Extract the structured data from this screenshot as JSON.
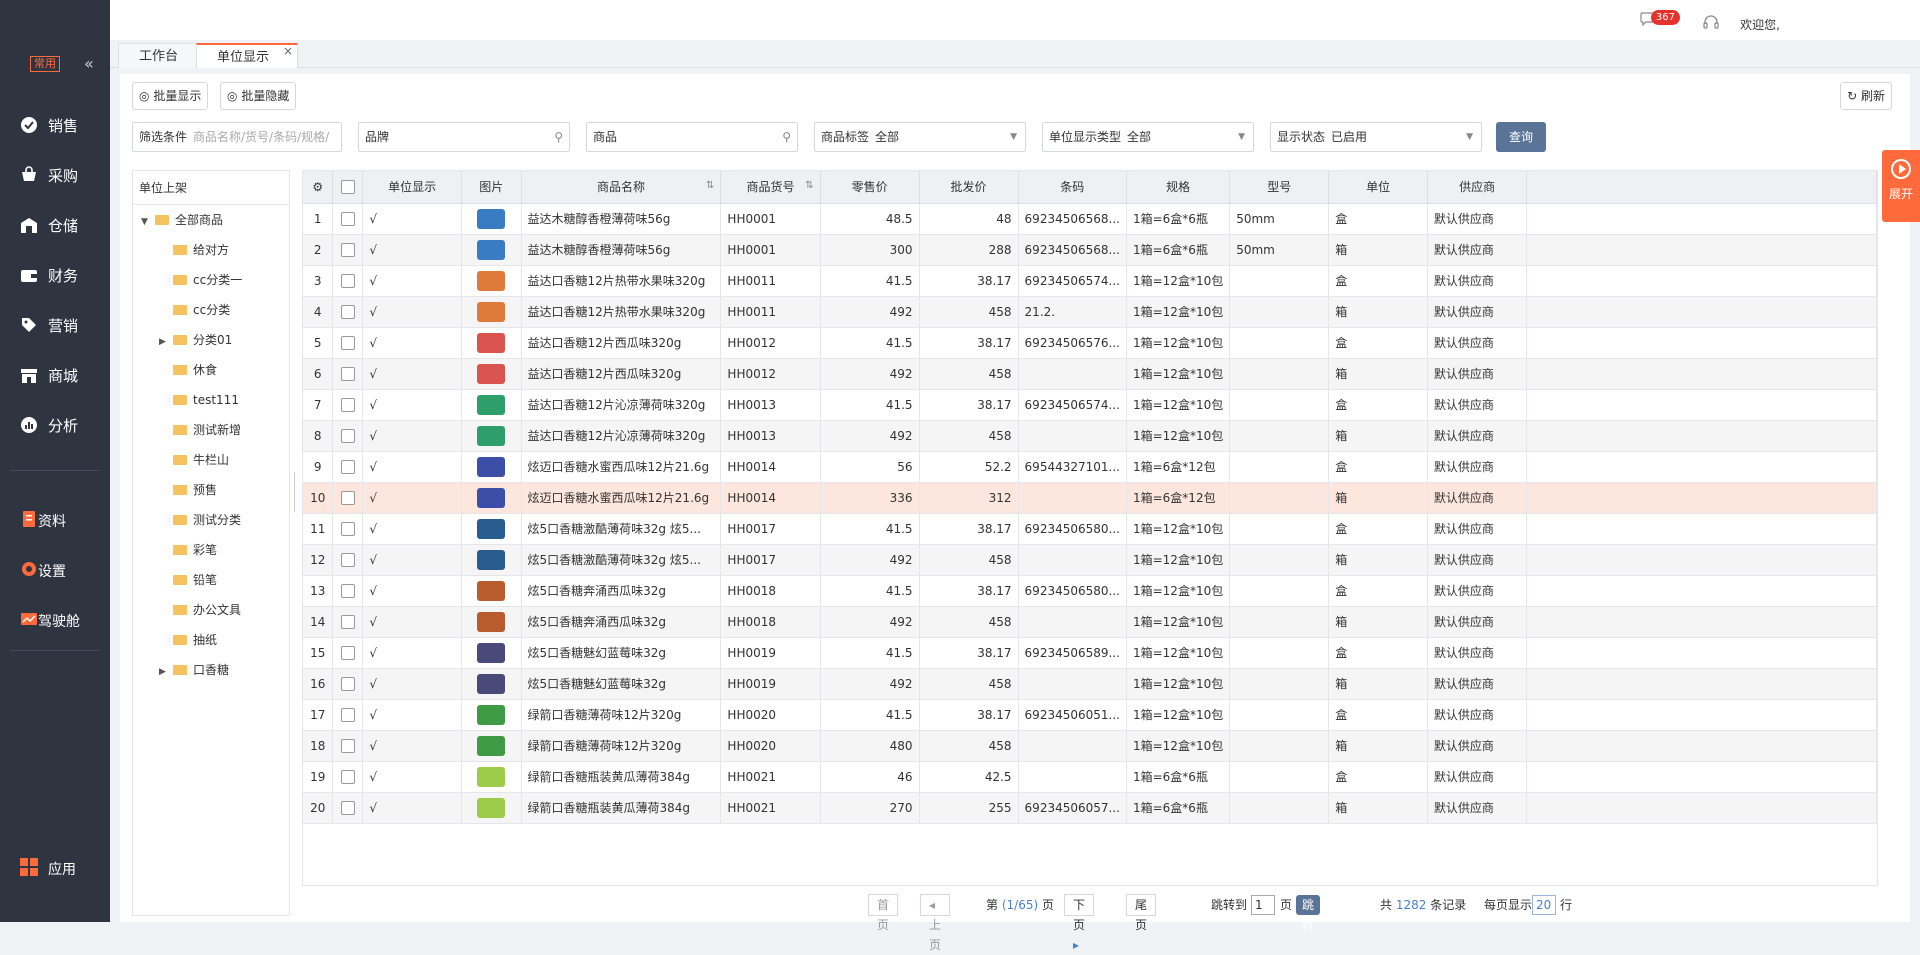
{
  "sidebar": {
    "common_tag": "常用",
    "collapse": "«",
    "items": [
      {
        "label": "销售",
        "icon": "sales-icon"
      },
      {
        "label": "采购",
        "icon": "purchase-icon"
      },
      {
        "label": "仓储",
        "icon": "warehouse-icon"
      },
      {
        "label": "财务",
        "icon": "finance-icon"
      },
      {
        "label": "营销",
        "icon": "marketing-icon"
      },
      {
        "label": "商城",
        "icon": "mall-icon"
      },
      {
        "label": "分析",
        "icon": "analysis-icon"
      }
    ],
    "items2": [
      {
        "label": "资料",
        "icon": "data-icon"
      },
      {
        "label": "设置",
        "icon": "settings-icon"
      },
      {
        "label": "驾驶舱",
        "icon": "cockpit-icon"
      }
    ],
    "app": "应用"
  },
  "topbar": {
    "badge": "367",
    "welcome": "欢迎您,"
  },
  "tabs": [
    {
      "label": "工作台"
    },
    {
      "label": "单位显示"
    }
  ],
  "toolbar": {
    "batch_show": "批量显示",
    "batch_hide": "批量隐藏",
    "refresh": "刷新"
  },
  "filters": {
    "f1_label": "筛选条件",
    "f1_placeholder": "商品名称/货号/条码/规格/",
    "f2_placeholder": "品牌",
    "f3_placeholder": "商品",
    "f4_label": "商品标签",
    "f4_value": "全部",
    "f5_label": "单位显示类型",
    "f5_value": "全部",
    "f6_label": "显示状态",
    "f6_value": "已启用",
    "query": "查询"
  },
  "tree": {
    "header": "单位上架",
    "root": "全部商品",
    "items": [
      {
        "label": "给对方",
        "expandable": false
      },
      {
        "label": "cc分类一",
        "expandable": false
      },
      {
        "label": "cc分类",
        "expandable": false
      },
      {
        "label": "分类01",
        "expandable": true
      },
      {
        "label": "休食",
        "expandable": false
      },
      {
        "label": "test111",
        "expandable": false
      },
      {
        "label": "测试新增",
        "expandable": false
      },
      {
        "label": "牛栏山",
        "expandable": false
      },
      {
        "label": "预售",
        "expandable": false
      },
      {
        "label": "测试分类",
        "expandable": false
      },
      {
        "label": "彩笔",
        "expandable": false
      },
      {
        "label": "铅笔",
        "expandable": false
      },
      {
        "label": "办公文具",
        "expandable": false
      },
      {
        "label": "抽纸",
        "expandable": false
      },
      {
        "label": "口香糖",
        "expandable": true
      }
    ]
  },
  "table": {
    "headers": [
      "单位显示",
      "图片",
      "商品名称",
      "商品货号",
      "零售价",
      "批发价",
      "条码",
      "规格",
      "型号",
      "单位",
      "供应商"
    ],
    "rows": [
      {
        "no": "1",
        "show": "√",
        "img": "#3a7cc4",
        "name": "益达木糖醇香橙薄荷味56g",
        "code": "HH0001",
        "retail": "48.5",
        "wholesale": "48",
        "barcode": "69234506568...",
        "spec": "1箱=6盒*6瓶",
        "model": "50mm",
        "unit": "盒",
        "supplier": "默认供应商"
      },
      {
        "no": "2",
        "show": "√",
        "img": "#3a7cc4",
        "name": "益达木糖醇香橙薄荷味56g",
        "code": "HH0001",
        "retail": "300",
        "wholesale": "288",
        "barcode": "69234506568...",
        "spec": "1箱=6盒*6瓶",
        "model": "50mm",
        "unit": "箱",
        "supplier": "默认供应商"
      },
      {
        "no": "3",
        "show": "√",
        "img": "#e07a3a",
        "name": "益达口香糖12片热带水果味320g",
        "code": "HH0011",
        "retail": "41.5",
        "wholesale": "38.17",
        "barcode": "69234506574...",
        "spec": "1箱=12盒*10包",
        "model": "",
        "unit": "盒",
        "supplier": "默认供应商"
      },
      {
        "no": "4",
        "show": "√",
        "img": "#e07a3a",
        "name": "益达口香糖12片热带水果味320g",
        "code": "HH0011",
        "retail": "492",
        "wholesale": "458",
        "barcode": "21.2.",
        "spec": "1箱=12盒*10包",
        "model": "",
        "unit": "箱",
        "supplier": "默认供应商"
      },
      {
        "no": "5",
        "show": "√",
        "img": "#d9534f",
        "name": "益达口香糖12片西瓜味320g",
        "code": "HH0012",
        "retail": "41.5",
        "wholesale": "38.17",
        "barcode": "69234506576...",
        "spec": "1箱=12盒*10包",
        "model": "",
        "unit": "盒",
        "supplier": "默认供应商"
      },
      {
        "no": "6",
        "show": "√",
        "img": "#d9534f",
        "name": "益达口香糖12片西瓜味320g",
        "code": "HH0012",
        "retail": "492",
        "wholesale": "458",
        "barcode": "",
        "spec": "1箱=12盒*10包",
        "model": "",
        "unit": "箱",
        "supplier": "默认供应商"
      },
      {
        "no": "7",
        "show": "√",
        "img": "#2e9e6a",
        "name": "益达口香糖12片沁凉薄荷味320g",
        "code": "HH0013",
        "retail": "41.5",
        "wholesale": "38.17",
        "barcode": "69234506574...",
        "spec": "1箱=12盒*10包",
        "model": "",
        "unit": "盒",
        "supplier": "默认供应商"
      },
      {
        "no": "8",
        "show": "√",
        "img": "#2e9e6a",
        "name": "益达口香糖12片沁凉薄荷味320g",
        "code": "HH0013",
        "retail": "492",
        "wholesale": "458",
        "barcode": "",
        "spec": "1箱=12盒*10包",
        "model": "",
        "unit": "箱",
        "supplier": "默认供应商"
      },
      {
        "no": "9",
        "show": "√",
        "img": "#3b4fa8",
        "name": "炫迈口香糖水蜜西瓜味12片21.6g",
        "code": "HH0014",
        "retail": "56",
        "wholesale": "52.2",
        "barcode": "69544327101...",
        "spec": "1箱=6盒*12包",
        "model": "",
        "unit": "盒",
        "supplier": "默认供应商"
      },
      {
        "no": "10",
        "show": "√",
        "img": "#3b4fa8",
        "name": "炫迈口香糖水蜜西瓜味12片21.6g",
        "code": "HH0014",
        "retail": "336",
        "wholesale": "312",
        "barcode": "",
        "spec": "1箱=6盒*12包",
        "model": "",
        "unit": "箱",
        "supplier": "默认供应商"
      },
      {
        "no": "11",
        "show": "√",
        "img": "#2a5d8f",
        "name": "炫5口香糖激酷薄荷味32g 炫5...",
        "code": "HH0017",
        "retail": "41.5",
        "wholesale": "38.17",
        "barcode": "69234506580...",
        "spec": "1箱=12盒*10包",
        "model": "",
        "unit": "盒",
        "supplier": "默认供应商"
      },
      {
        "no": "12",
        "show": "√",
        "img": "#2a5d8f",
        "name": "炫5口香糖激酷薄荷味32g 炫5...",
        "code": "HH0017",
        "retail": "492",
        "wholesale": "458",
        "barcode": "",
        "spec": "1箱=12盒*10包",
        "model": "",
        "unit": "箱",
        "supplier": "默认供应商"
      },
      {
        "no": "13",
        "show": "√",
        "img": "#b85c2e",
        "name": "炫5口香糖奔涌西瓜味32g",
        "code": "HH0018",
        "retail": "41.5",
        "wholesale": "38.17",
        "barcode": "69234506580...",
        "spec": "1箱=12盒*10包",
        "model": "",
        "unit": "盒",
        "supplier": "默认供应商"
      },
      {
        "no": "14",
        "show": "√",
        "img": "#b85c2e",
        "name": "炫5口香糖奔涌西瓜味32g",
        "code": "HH0018",
        "retail": "492",
        "wholesale": "458",
        "barcode": "",
        "spec": "1箱=12盒*10包",
        "model": "",
        "unit": "箱",
        "supplier": "默认供应商"
      },
      {
        "no": "15",
        "show": "√",
        "img": "#4a4a7a",
        "name": "炫5口香糖魅幻蓝莓味32g",
        "code": "HH0019",
        "retail": "41.5",
        "wholesale": "38.17",
        "barcode": "69234506589...",
        "spec": "1箱=12盒*10包",
        "model": "",
        "unit": "盒",
        "supplier": "默认供应商"
      },
      {
        "no": "16",
        "show": "√",
        "img": "#4a4a7a",
        "name": "炫5口香糖魅幻蓝莓味32g",
        "code": "HH0019",
        "retail": "492",
        "wholesale": "458",
        "barcode": "",
        "spec": "1箱=12盒*10包",
        "model": "",
        "unit": "箱",
        "supplier": "默认供应商"
      },
      {
        "no": "17",
        "show": "√",
        "img": "#3f9a45",
        "name": "绿箭口香糖薄荷味12片320g",
        "code": "HH0020",
        "retail": "41.5",
        "wholesale": "38.17",
        "barcode": "69234506051...",
        "spec": "1箱=12盒*10包",
        "model": "",
        "unit": "盒",
        "supplier": "默认供应商"
      },
      {
        "no": "18",
        "show": "√",
        "img": "#3f9a45",
        "name": "绿箭口香糖薄荷味12片320g",
        "code": "HH0020",
        "retail": "480",
        "wholesale": "458",
        "barcode": "",
        "spec": "1箱=12盒*10包",
        "model": "",
        "unit": "箱",
        "supplier": "默认供应商"
      },
      {
        "no": "19",
        "show": "√",
        "img": "#9ccc4a",
        "name": "绿箭口香糖瓶装黄瓜薄荷384g",
        "code": "HH0021",
        "retail": "46",
        "wholesale": "42.5",
        "barcode": "",
        "spec": "1箱=6盒*6瓶",
        "model": "",
        "unit": "盒",
        "supplier": "默认供应商"
      },
      {
        "no": "20",
        "show": "√",
        "img": "#9ccc4a",
        "name": "绿箭口香糖瓶装黄瓜薄荷384g",
        "code": "HH0021",
        "retail": "270",
        "wholesale": "255",
        "barcode": "69234506057...",
        "spec": "1箱=6盒*6瓶",
        "model": "",
        "unit": "箱",
        "supplier": "默认供应商"
      }
    ]
  },
  "pager": {
    "first": "首页",
    "prev": "上页",
    "page_prefix": "第",
    "page_info": "(1/65)",
    "page_suffix": "页",
    "next": "下页",
    "last": "尾页",
    "jump_label": "跳转到",
    "jump_value": "1",
    "jump_suffix": "页",
    "jump_btn": "跳转",
    "total_prefix": "共",
    "total": "1282",
    "total_suffix": "条记录",
    "per_page_label": "每页显示",
    "per_page": "20",
    "per_page_suffix": "行"
  },
  "float": {
    "label": "展开"
  },
  "colors": {
    "accent": "#ff6a3d",
    "sidebar": "#2f3441",
    "query_btn": "#5a7498",
    "highlight_row": "#fde6de"
  }
}
